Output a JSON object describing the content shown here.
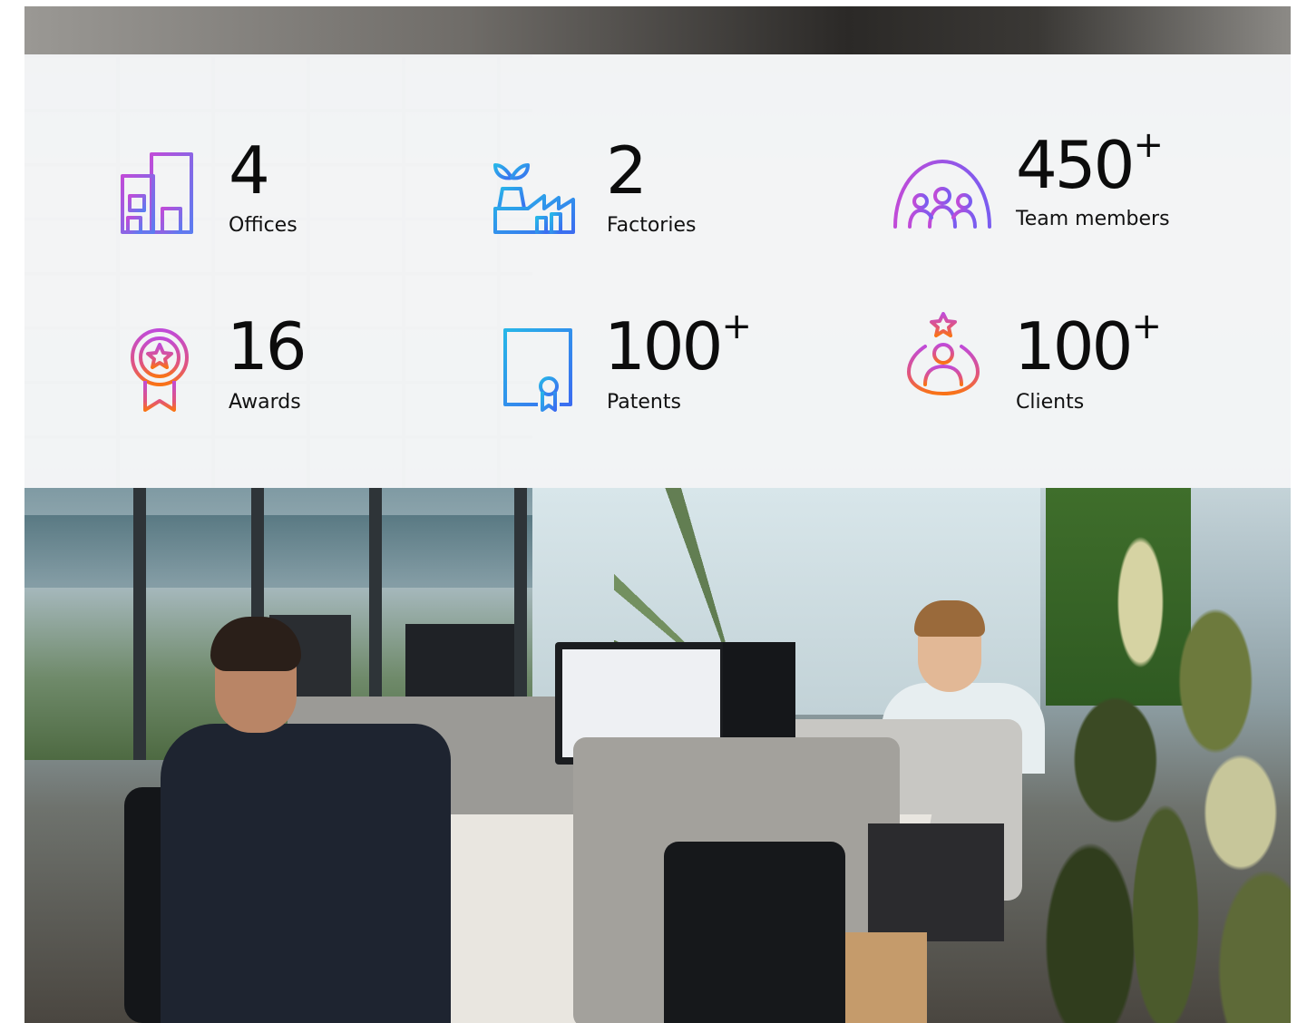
{
  "stats": [
    {
      "value": "4",
      "suffix": "",
      "label": "Offices",
      "icon": "building-icon"
    },
    {
      "value": "2",
      "suffix": "",
      "label": "Factories",
      "icon": "factory-icon"
    },
    {
      "value": "450",
      "suffix": "+",
      "label": "Team members",
      "icon": "team-icon"
    },
    {
      "value": "16",
      "suffix": "",
      "label": "Awards",
      "icon": "award-icon"
    },
    {
      "value": "100",
      "suffix": "+",
      "label": "Patents",
      "icon": "certificate-icon"
    },
    {
      "value": "100",
      "suffix": "+",
      "label": "Clients",
      "icon": "client-icon"
    }
  ],
  "colors": {
    "purple": "#8a5cf6",
    "blue": "#3b82f6",
    "magenta": "#d946ef",
    "orange": "#f97316"
  }
}
